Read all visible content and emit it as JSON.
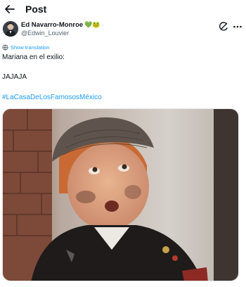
{
  "header": {
    "title": "Post",
    "back_icon": "arrow-left-icon"
  },
  "author": {
    "display_name": "Ed Navarro-Monroe",
    "emoji": "💚🐸",
    "handle": "@Edwin_Louvier"
  },
  "actions": {
    "grok_icon": "grok-icon",
    "more_icon": "more-icon"
  },
  "translate": {
    "label": "Show translation"
  },
  "post": {
    "line1": "Mariana en el exilio:",
    "line2": "JAJAJA",
    "hashtag": "#LaCasaDeLosFamososMéxico"
  },
  "colors": {
    "accent": "#1d9bf0",
    "text": "#0f1419",
    "muted": "#536471"
  }
}
